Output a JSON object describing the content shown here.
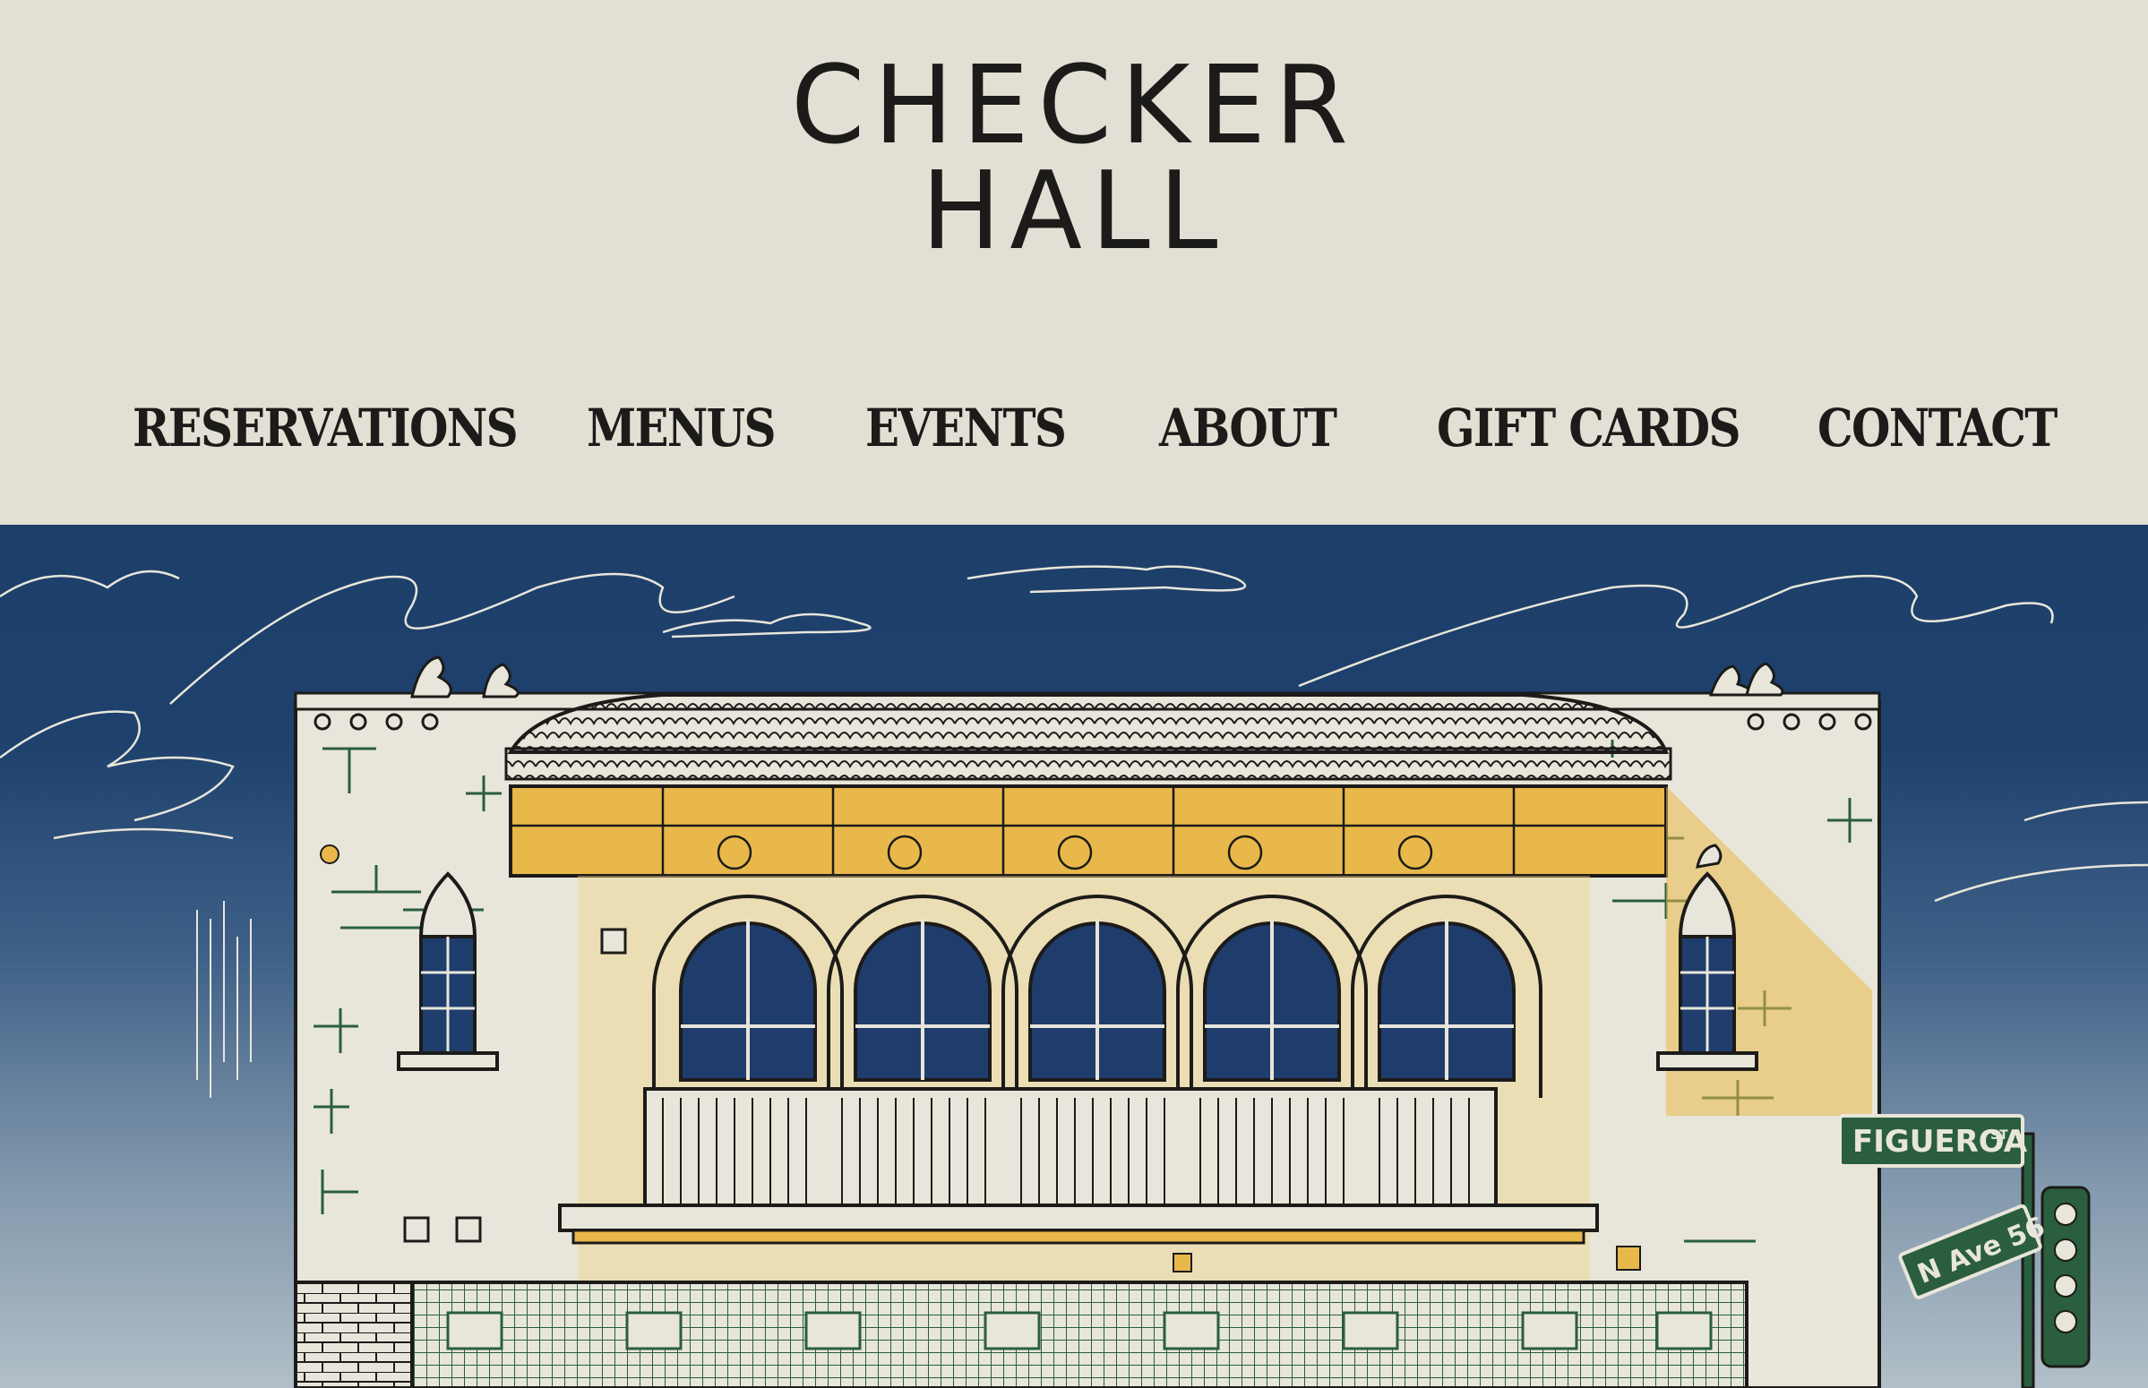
{
  "logo": {
    "line1": "CHECKER",
    "line2": "HALL"
  },
  "nav": {
    "items": [
      {
        "label": "RESERVATIONS"
      },
      {
        "label": "MENUS"
      },
      {
        "label": "EVENTS"
      },
      {
        "label": "ABOUT"
      },
      {
        "label": "GIFT CARDS"
      },
      {
        "label": "CONTACT"
      }
    ]
  },
  "hero": {
    "street_sign_1": "FIGUEROA",
    "street_sign_1_suffix": "ST",
    "street_sign_2": "N Ave 56"
  },
  "colors": {
    "background": "#e2e0d4",
    "sky_top": "#1d3f6a",
    "sky_bottom": "#a8b8c4",
    "building": "#e8e6da",
    "gold": "#e8b84a",
    "green": "#2a5e3e",
    "ink": "#1c1b19"
  }
}
